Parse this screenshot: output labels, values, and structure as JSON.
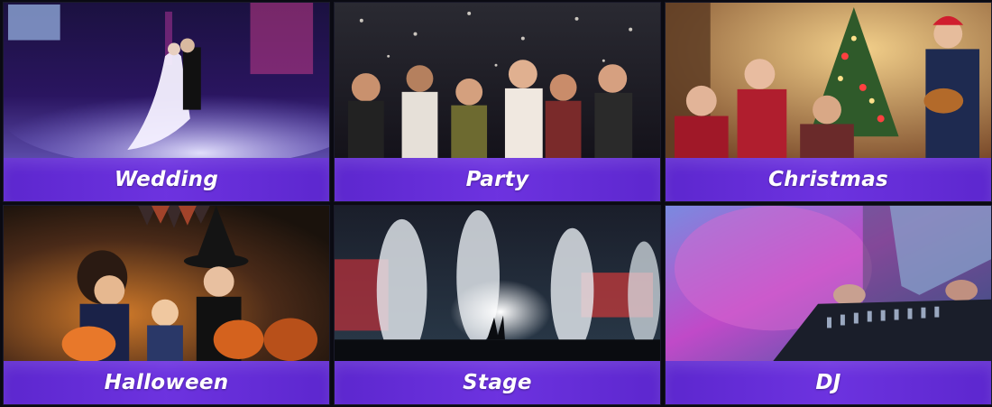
{
  "tiles": [
    {
      "label": "Wedding",
      "scene": "wedding-photo"
    },
    {
      "label": "Party",
      "scene": "party-photo"
    },
    {
      "label": "Christmas",
      "scene": "christmas-photo"
    },
    {
      "label": "Halloween",
      "scene": "halloween-photo"
    },
    {
      "label": "Stage",
      "scene": "stage-photo"
    },
    {
      "label": "DJ",
      "scene": "dj-photo"
    }
  ],
  "colors": {
    "label_bar": "#6a2fe0",
    "label_text": "#ffffff"
  }
}
